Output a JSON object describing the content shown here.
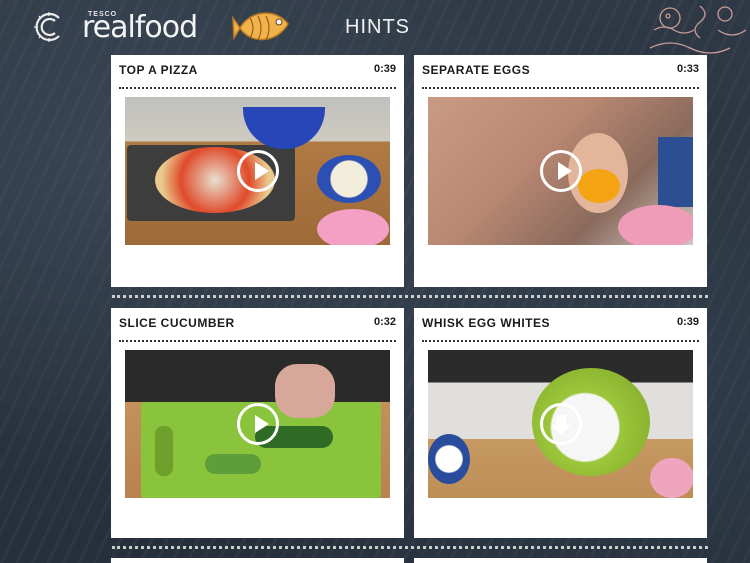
{
  "header": {
    "brand_small": "TESCO",
    "brand": "realfood",
    "title": "HINTS"
  },
  "cards": [
    {
      "title": "TOP A PIZZA",
      "duration": "0:39",
      "action": "play"
    },
    {
      "title": "SEPARATE EGGS",
      "duration": "0:33",
      "action": "play"
    },
    {
      "title": "SLICE CUCUMBER",
      "duration": "0:32",
      "action": "play"
    },
    {
      "title": "WHISK EGG WHITES",
      "duration": "0:39",
      "action": "download"
    }
  ],
  "icons": {
    "logo": "realfood-logo-icon",
    "fish": "fish-icon",
    "play": "play-icon",
    "download": "download-icon"
  },
  "colors": {
    "background": "#2b3440",
    "card": "#ffffff",
    "accent_fish": "#e8a33a"
  }
}
